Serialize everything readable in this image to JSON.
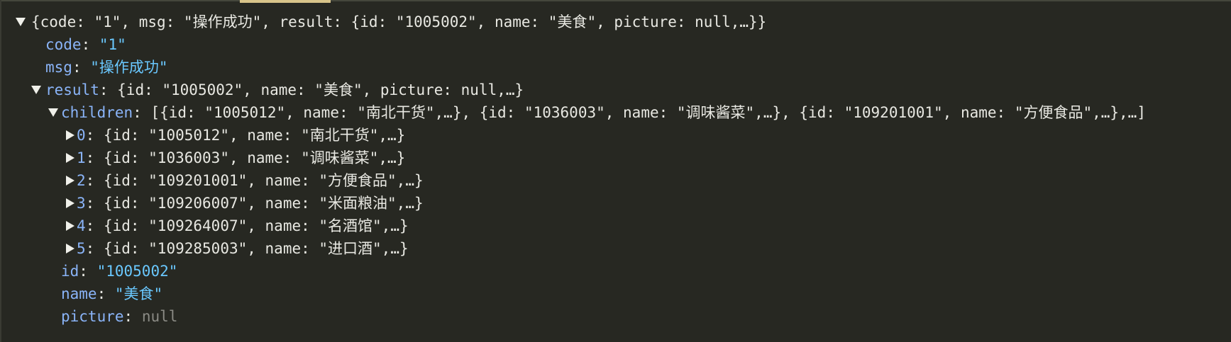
{
  "colors": {
    "background": "#272822",
    "key": "#8ab4f8",
    "string_value": "#6ac8ff",
    "null_value": "#8b8b85",
    "preview_text": "#e8e8e2"
  },
  "tree": {
    "root_preview": "{code: \"1\", msg: \"操作成功\", result: {id: \"1005002\", name: \"美食\", picture: null,…}}",
    "code": {
      "key": "code",
      "value": "\"1\""
    },
    "msg": {
      "key": "msg",
      "value": "\"操作成功\""
    },
    "result": {
      "key": "result",
      "preview": "{id: \"1005002\", name: \"美食\", picture: null,…}",
      "children": {
        "key": "children",
        "preview": "[{id: \"1005012\", name: \"南北干货\",…}, {id: \"1036003\", name: \"调味酱菜\",…}, {id: \"109201001\", name: \"方便食品\",…},…]",
        "items": [
          {
            "index": "0",
            "preview": "{id: \"1005012\", name: \"南北干货\",…}"
          },
          {
            "index": "1",
            "preview": "{id: \"1036003\", name: \"调味酱菜\",…}"
          },
          {
            "index": "2",
            "preview": "{id: \"109201001\", name: \"方便食品\",…}"
          },
          {
            "index": "3",
            "preview": "{id: \"109206007\", name: \"米面粮油\",…}"
          },
          {
            "index": "4",
            "preview": "{id: \"109264007\", name: \"名酒馆\",…}"
          },
          {
            "index": "5",
            "preview": "{id: \"109285003\", name: \"进口酒\",…}"
          }
        ]
      },
      "id": {
        "key": "id",
        "value": "\"1005002\""
      },
      "name": {
        "key": "name",
        "value": "\"美食\""
      },
      "picture": {
        "key": "picture",
        "value": "null"
      }
    }
  }
}
